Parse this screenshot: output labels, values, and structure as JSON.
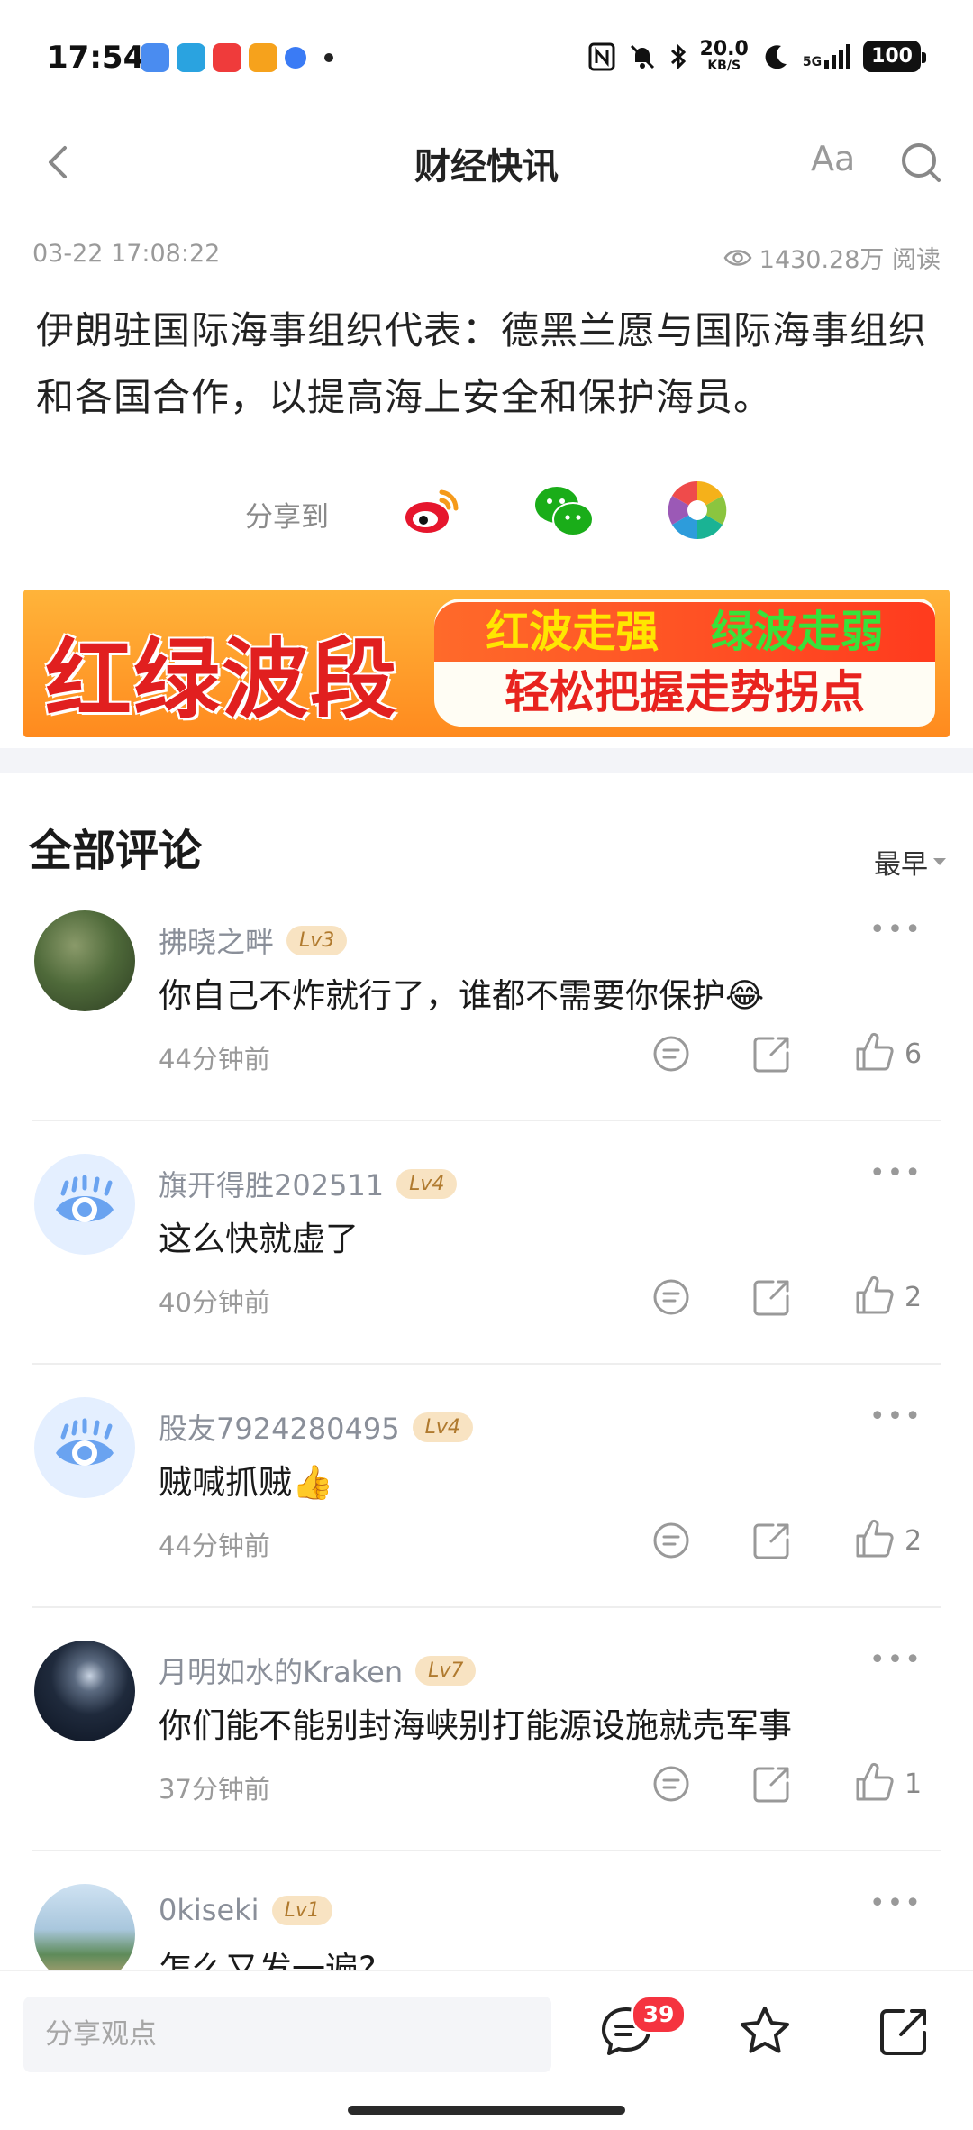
{
  "status_bar": {
    "time": "17:54",
    "net_speed": "20.0",
    "net_unit": "KB/S",
    "signal_label": "5G",
    "battery": "100",
    "app_icons": [
      "app-icon-1",
      "telegram-icon",
      "video-icon",
      "bilibili-icon",
      "app-icon-5"
    ]
  },
  "header": {
    "title": "财经快讯",
    "font_size_label": "Aa"
  },
  "article": {
    "timestamp": "03-22 17:08:22",
    "views": "1430.28万 阅读",
    "body": "伊朗驻国际海事组织代表：德黑兰愿与国际海事组织和各国合作，以提高海上安全和保护海员。"
  },
  "share": {
    "label": "分享到",
    "targets": [
      "weibo-icon",
      "wechat-icon",
      "moments-icon"
    ]
  },
  "banner": {
    "left_text": "红绿波段",
    "line1_red": "红波走强",
    "line1_green": "绿波走弱",
    "line2": "轻松把握走势拐点"
  },
  "comments_section": {
    "title": "全部评论",
    "sort_label": "最早",
    "items": [
      {
        "user": "拂晓之畔",
        "level": "Lv3",
        "text": "你自己不炸就行了，谁都不需要你保护😂",
        "time": "44分钟前",
        "likes": "6",
        "avatar": "photo-avatar"
      },
      {
        "user": "旗开得胜202511",
        "level": "Lv4",
        "text": "这么快就虚了",
        "time": "40分钟前",
        "likes": "2",
        "avatar": "default-avatar"
      },
      {
        "user": "股友7924280495",
        "level": "Lv4",
        "text": "贼喊抓贼👍",
        "time": "44分钟前",
        "likes": "2",
        "avatar": "default-avatar"
      },
      {
        "user": "月明如水的Kraken",
        "level": "Lv7",
        "text": "你们能不能别封海峡别打能源设施就売军事",
        "time": "37分钟前",
        "likes": "1",
        "avatar": "moon-avatar"
      },
      {
        "user": "0kiseki",
        "level": "Lv1",
        "text": "怎么又发一遍?",
        "time": "",
        "likes": "",
        "avatar": "beach-avatar"
      }
    ]
  },
  "bottom_bar": {
    "input_placeholder": "分享观点",
    "comment_badge": "39"
  },
  "colors": {
    "accent_red": "#f5333f",
    "muted_text": "#9a9a9a",
    "level_badge_bg": "#f8e3c2"
  }
}
